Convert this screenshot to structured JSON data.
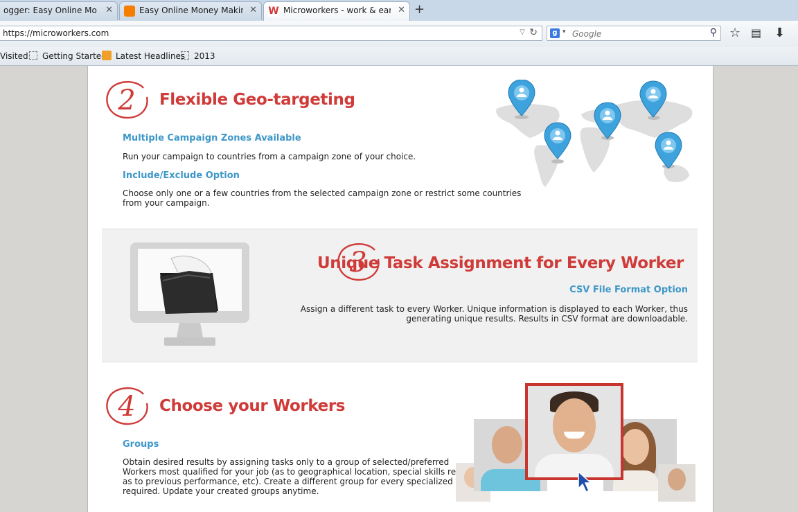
{
  "tabs": [
    {
      "title": "ogger: Easy Online Mone...",
      "favicon": "blogger-icon"
    },
    {
      "title": "Easy Online Money Makin...",
      "favicon": "blogger-icon"
    },
    {
      "title": "Microworkers - work & ear...",
      "favicon": "microworkers-icon"
    }
  ],
  "nav": {
    "url": "https://microworkers.com",
    "search_placeholder": "Google"
  },
  "bookmarks": [
    "Visited",
    "Getting Started",
    "Latest Headlines",
    "2013"
  ],
  "sections": [
    {
      "number": "2",
      "title": "Flexible Geo-targeting",
      "items": [
        {
          "heading": "Multiple Campaign Zones Available",
          "text": "Run your campaign to countries from a campaign zone of your choice."
        },
        {
          "heading": "Include/Exclude Option",
          "text_line1": "Choose only one or a few countries from the selected campaign zone or restrict some countries",
          "text_line2": "from your campaign."
        }
      ]
    },
    {
      "number": "3",
      "title": "Unique Task Assignment for Every Worker",
      "items": [
        {
          "heading": "CSV File Format Option",
          "text_line1": "Assign a different task to every Worker. Unique information is displayed to each Worker, thus",
          "text_line2": "generating unique results. Results in CSV format are downloadable."
        }
      ]
    },
    {
      "number": "4",
      "title": "Choose your Workers",
      "items": [
        {
          "heading": "Groups",
          "lines": [
            "Obtain desired results by assigning tasks only to a group of selected/preferred",
            "Workers most qualified for your job (as to geographical location, special skills required,",
            "as to previous performance, etc). Create a different group for every specialized tasks",
            "required. Update your created groups anytime."
          ]
        }
      ]
    }
  ],
  "colors": {
    "accent_red": "#cf3b38",
    "link_blue": "#3e97c8",
    "pin_blue": "#3ea3dc"
  }
}
